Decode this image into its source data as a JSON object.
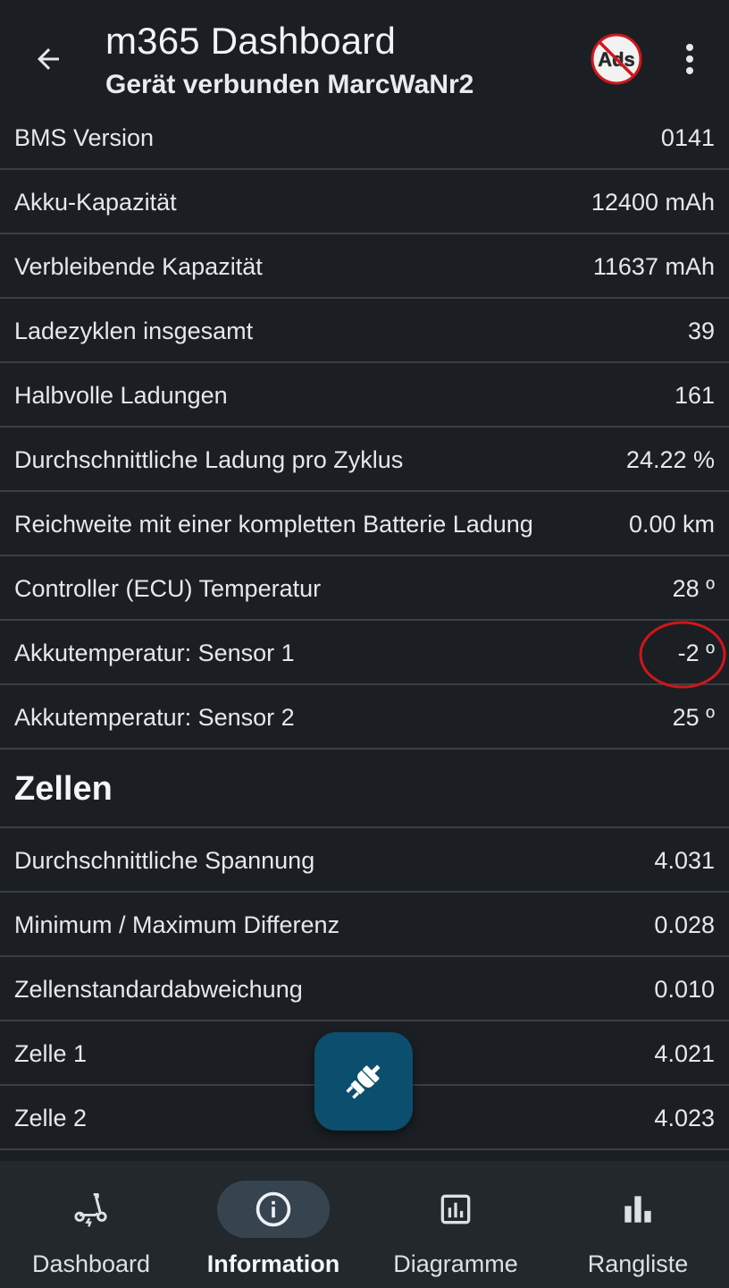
{
  "appbar": {
    "title": "m365 Dashboard",
    "subtitle": "Gerät verbunden MarcWaNr2",
    "ads_label": "Ads"
  },
  "rows": [
    {
      "label": "BMS Version",
      "value": "0141"
    },
    {
      "label": "Akku-Kapazität",
      "value": "12400 mAh"
    },
    {
      "label": "Verbleibende Kapazität",
      "value": "11637 mAh"
    },
    {
      "label": "Ladezyklen insgesamt",
      "value": "39"
    },
    {
      "label": "Halbvolle Ladungen",
      "value": "161"
    },
    {
      "label": "Durchschnittliche Ladung pro Zyklus",
      "value": "24.22 %"
    },
    {
      "label": "Reichweite mit einer kompletten Batterie Ladung",
      "value": "0.00 km"
    },
    {
      "label": "Controller (ECU) Temperatur",
      "value": "28 º"
    },
    {
      "label": "Akkutemperatur: Sensor 1",
      "value": "-2 º"
    },
    {
      "label": "Akkutemperatur: Sensor 2",
      "value": "25 º"
    }
  ],
  "cells_section": {
    "heading": "Zellen",
    "rows": [
      {
        "label": "Durchschnittliche Spannung",
        "value": "4.031"
      },
      {
        "label": "Minimum / Maximum Differenz",
        "value": "0.028"
      },
      {
        "label": "Zellenstandardabweichung",
        "value": "0.010"
      },
      {
        "label": "Zelle 1",
        "value": "4.021"
      },
      {
        "label": "Zelle 2",
        "value": "4.023"
      }
    ]
  },
  "bottom_nav": [
    {
      "label": "Dashboard",
      "icon": "scooter-icon",
      "active": false
    },
    {
      "label": "Information",
      "icon": "info-icon",
      "active": true
    },
    {
      "label": "Diagramme",
      "icon": "chart-icon",
      "active": false
    },
    {
      "label": "Rangliste",
      "icon": "bar-chart-icon",
      "active": false
    }
  ],
  "colors": {
    "background": "#1b1f23",
    "divider": "#3a3f44",
    "fab": "#0c4e6e",
    "nav_active_pill": "#364450",
    "annotation": "#d0161b"
  }
}
